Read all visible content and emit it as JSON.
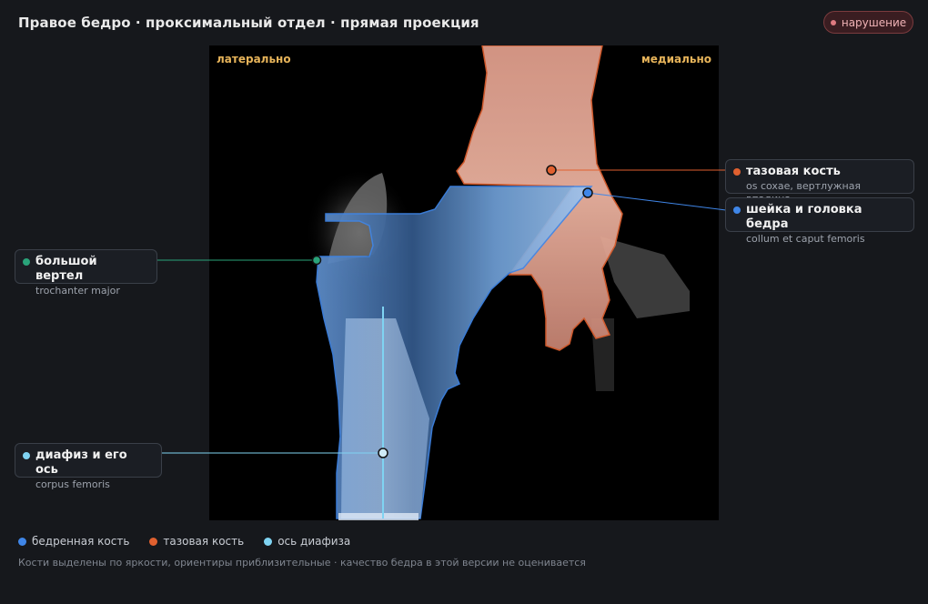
{
  "header": {
    "title": "Правое бедро · проксимальный отдел · прямая проекция",
    "status_badge": "нарушение"
  },
  "viewer": {
    "orientation_left": "латерально",
    "orientation_right": "медиально"
  },
  "callouts": {
    "pelvis": {
      "label": "тазовая кость",
      "latin": "os coxae, вертлужная впадина",
      "color": "#e0602f"
    },
    "neck": {
      "label": "шейка и головка бедра",
      "latin": "collum et caput femoris",
      "color": "#3f86e8"
    },
    "trochanter": {
      "label": "большой вертел",
      "latin": "trochanter major",
      "color": "#2aa37a"
    },
    "shaft": {
      "label": "диафиз и его ось",
      "latin": "corpus femoris",
      "color": "#7fd3f2"
    }
  },
  "legend": [
    {
      "label": "бедренная кость",
      "color": "#3f86e8"
    },
    {
      "label": "тазовая кость",
      "color": "#e0602f"
    },
    {
      "label": "ось диафиза",
      "color": "#7fd3f2"
    }
  ],
  "footnote": "Кости выделены по яркости, ориентиры приблизительные · качество бедра в этой версии не оценивается"
}
